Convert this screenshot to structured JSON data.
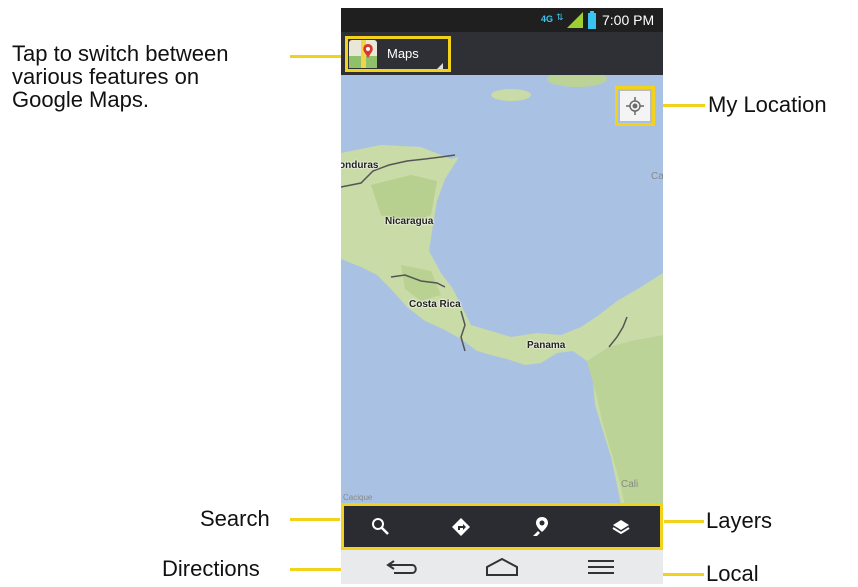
{
  "callouts": {
    "tap_switch": [
      "Tap to switch between",
      "various features on",
      "Google Maps."
    ],
    "my_location": "My Location",
    "search": "Search",
    "directions": "Directions",
    "layers": "Layers",
    "local": "Local"
  },
  "status_bar": {
    "network": "4G",
    "time": "7:00 PM"
  },
  "action_bar": {
    "app_name": "Maps"
  },
  "map": {
    "labels": {
      "honduras": "onduras",
      "nicaragua": "Nicaragua",
      "costa_rica": "Costa Rica",
      "panama": "Panama",
      "cali": "Cali",
      "ca_edge": "Ca",
      "cacique": "Cacique"
    }
  },
  "bottom_bar": {
    "buttons": [
      "search-icon",
      "directions-icon",
      "local-icon",
      "layers-icon"
    ]
  },
  "nav_bar": {
    "buttons": [
      "back-icon",
      "home-icon",
      "menu-icon"
    ]
  },
  "colors": {
    "callout_yellow": "#f2d21a",
    "sea": "#a9c2e3",
    "land": "#c9dba6",
    "border_line": "#555555"
  }
}
